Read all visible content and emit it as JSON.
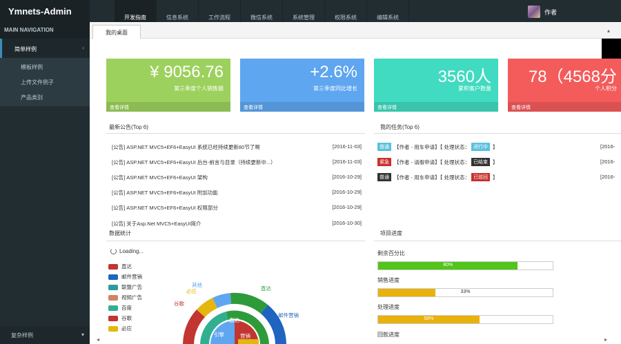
{
  "app": {
    "brand": "Ymnets-Admin",
    "user_name": "作者"
  },
  "nav": {
    "tabs": [
      "开发指南",
      "信息系统",
      "工作流程",
      "微信系统",
      "系统管理",
      "权限系统",
      "编辑系统"
    ]
  },
  "sidebar": {
    "header": "MAIN NAVIGATION",
    "group": "简单样例",
    "items": [
      {
        "label": "模板样例"
      },
      {
        "label": "上传文件例子"
      },
      {
        "label": "产品类别"
      }
    ],
    "bottom": "复杂样例"
  },
  "page_tab": "我的桌面",
  "cards": [
    {
      "value": "¥ 9056.76",
      "desc": "第三季度个人销售额",
      "more": "查看详情",
      "color": "#9cd15d"
    },
    {
      "value": "+2.6%",
      "desc": "第三季度同比增长",
      "more": "查看详情",
      "color": "#5ea6f0"
    },
    {
      "value": "3560人",
      "desc": "累积客户数量",
      "more": "查看详情",
      "color": "#40dbc0"
    },
    {
      "value": "78（4568分",
      "desc": "个人积分",
      "more": "查看详情",
      "color": "#f45b5b"
    }
  ],
  "news": {
    "title": "最新公告(Top 6)",
    "rows": [
      {
        "text": "[公告] ASP.NET MVC5+EF6+EasyUI 系统已经持续更新80节了啊",
        "date": "[2016-11-03]"
      },
      {
        "text": "[公告] ASP.NET MVC5+EF6+EasyUI 后台-前言与目录（持续更新中...）",
        "date": "[2016-11-03]"
      },
      {
        "text": "[公告] ASP.NET MVC5+EF6+EasyUI 架构",
        "date": "[2016-10-29]"
      },
      {
        "text": "[公告] ASP.NET MVC5+EF6+EasyUI 附加功能",
        "date": "[2016-10-29]"
      },
      {
        "text": "[公告] ASP.NET MVC5+EF6+EasyUI 权限部分",
        "date": "[2016-10-29]"
      },
      {
        "text": "[公告] 关于Asp.Net MVC5+EasyUI简介",
        "date": "[2016-10-30]"
      }
    ]
  },
  "tasks": {
    "title": "我的任务(Top 6)",
    "rows": [
      {
        "badge": "普通",
        "badge_color": "#5bc0de",
        "text": "【作者 - 用车申请】【 处理状态：",
        "status": "进行中",
        "status_color": "#5bc0de",
        "date": "[2016-"
      },
      {
        "badge": "紧急",
        "badge_color": "#c9302c",
        "text": "【作者 - 请假申请】【 处理状态：",
        "status": "已结束",
        "status_color": "#333333",
        "date": "[2016-"
      },
      {
        "badge": "普通",
        "badge_color": "#333333",
        "text": "【作者 - 用车申请】【 处理状态：",
        "status": "已驳回",
        "status_color": "#c9302c",
        "date": "[2016-"
      }
    ]
  },
  "stats": {
    "title": "数据统计",
    "loading": "Loading..."
  },
  "progress": {
    "title": "项目进度",
    "items": [
      {
        "label": "剩余百分比",
        "pct": 80,
        "text": "80%",
        "color": "#52c41a"
      },
      {
        "label": "销售进度",
        "pct": 33,
        "text": "33%",
        "color": "#e8b10c"
      },
      {
        "label": "处理进度",
        "pct": 58,
        "text": "58%",
        "color": "#e8b10c"
      },
      {
        "label": "回款进度",
        "pct": 0,
        "text": "",
        "color": "#e8b10c"
      }
    ]
  },
  "legend": [
    {
      "name": "直达",
      "color": "#c23531"
    },
    {
      "name": "邮件营销",
      "color": "#1f64c0"
    },
    {
      "name": "联盟广告",
      "color": "#2f9a9c"
    },
    {
      "name": "视频广告",
      "color": "#d48265"
    },
    {
      "name": "百度",
      "color": "#30b090"
    },
    {
      "name": "谷歌",
      "color": "#c23531"
    },
    {
      "name": "必应",
      "color": "#e3b70e"
    }
  ],
  "donut_labels": [
    "其他",
    "直达",
    "必应",
    "谷歌",
    "邮件营销",
    "直达",
    "营销",
    "引擎"
  ]
}
